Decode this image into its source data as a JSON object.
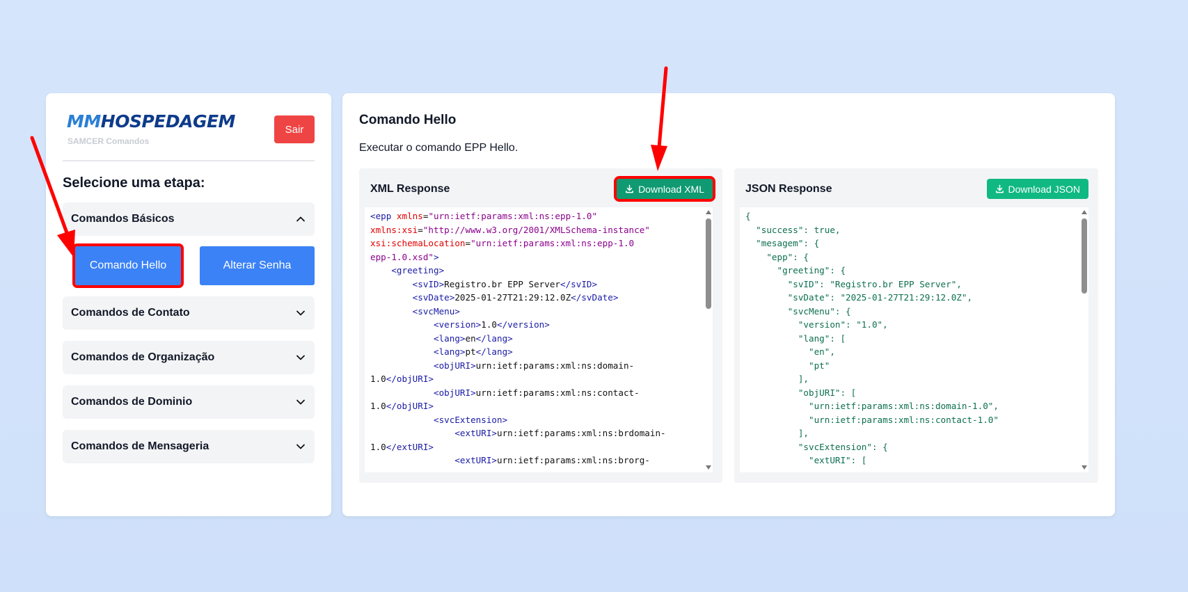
{
  "brand": {
    "logo_part1": "MM",
    "logo_part2": "HOSPEDAGEM",
    "subtitle": "SAMCER Comandos"
  },
  "header": {
    "logout_label": "Sair"
  },
  "sidebar": {
    "title": "Selecione uma etapa:",
    "sections": [
      {
        "label": "Comandos Básicos",
        "expanded": true
      },
      {
        "label": "Comandos de Contato",
        "expanded": false
      },
      {
        "label": "Comandos de Organização",
        "expanded": false
      },
      {
        "label": "Comandos de Dominio",
        "expanded": false
      },
      {
        "label": "Comandos de Mensageria",
        "expanded": false
      }
    ],
    "basic_commands": [
      "Comando Hello",
      "Alterar Senha"
    ]
  },
  "main": {
    "title": "Comando Hello",
    "description": "Executar o comando EPP Hello.",
    "xml": {
      "title": "XML Response",
      "download_label": "Download XML",
      "lines": [
        [
          [
            "t",
            "<epp "
          ],
          [
            "a",
            "xmlns"
          ],
          [
            "x",
            "="
          ],
          [
            "v",
            "\"urn:ietf:params:xml:ns:epp-1.0\""
          ]
        ],
        [
          [
            "a",
            "xmlns:xsi"
          ],
          [
            "x",
            "="
          ],
          [
            "v",
            "\"http://www.w3.org/2001/XMLSchema-instance\""
          ]
        ],
        [
          [
            "a",
            "xsi:schemaLocation"
          ],
          [
            "x",
            "="
          ],
          [
            "v",
            "\"urn:ietf:params:xml:ns:epp-1.0"
          ]
        ],
        [
          [
            "v",
            "epp-1.0.xsd\""
          ],
          [
            "t",
            ">"
          ]
        ],
        [
          [
            "x",
            "    "
          ],
          [
            "t",
            "<greeting>"
          ]
        ],
        [
          [
            "x",
            "        "
          ],
          [
            "t",
            "<svID>"
          ],
          [
            "x",
            "Registro.br EPP Server"
          ],
          [
            "t",
            "</svID>"
          ]
        ],
        [
          [
            "x",
            "        "
          ],
          [
            "t",
            "<svDate>"
          ],
          [
            "x",
            "2025-01-27T21:29:12.0Z"
          ],
          [
            "t",
            "</svDate>"
          ]
        ],
        [
          [
            "x",
            "        "
          ],
          [
            "t",
            "<svcMenu>"
          ]
        ],
        [
          [
            "x",
            "            "
          ],
          [
            "t",
            "<version>"
          ],
          [
            "x",
            "1.0"
          ],
          [
            "t",
            "</version>"
          ]
        ],
        [
          [
            "x",
            "            "
          ],
          [
            "t",
            "<lang>"
          ],
          [
            "x",
            "en"
          ],
          [
            "t",
            "</lang>"
          ]
        ],
        [
          [
            "x",
            "            "
          ],
          [
            "t",
            "<lang>"
          ],
          [
            "x",
            "pt"
          ],
          [
            "t",
            "</lang>"
          ]
        ],
        [
          [
            "x",
            "            "
          ],
          [
            "t",
            "<objURI>"
          ],
          [
            "x",
            "urn:ietf:params:xml:ns:domain-"
          ]
        ],
        [
          [
            "x",
            "1.0"
          ],
          [
            "t",
            "</objURI>"
          ]
        ],
        [
          [
            "x",
            "            "
          ],
          [
            "t",
            "<objURI>"
          ],
          [
            "x",
            "urn:ietf:params:xml:ns:contact-"
          ]
        ],
        [
          [
            "x",
            "1.0"
          ],
          [
            "t",
            "</objURI>"
          ]
        ],
        [
          [
            "x",
            "            "
          ],
          [
            "t",
            "<svcExtension>"
          ]
        ],
        [
          [
            "x",
            "                "
          ],
          [
            "t",
            "<extURI>"
          ],
          [
            "x",
            "urn:ietf:params:xml:ns:brdomain-"
          ]
        ],
        [
          [
            "x",
            "1.0"
          ],
          [
            "t",
            "</extURI>"
          ]
        ],
        [
          [
            "x",
            "                "
          ],
          [
            "t",
            "<extURI>"
          ],
          [
            "x",
            "urn:ietf:params:xml:ns:brorg-"
          ]
        ]
      ]
    },
    "json": {
      "title": "JSON Response",
      "download_label": "Download JSON",
      "lines": [
        "{",
        "  \"success\": true,",
        "  \"mesagem\": {",
        "    \"epp\": {",
        "      \"greeting\": {",
        "        \"svID\": \"Registro.br EPP Server\",",
        "        \"svDate\": \"2025-01-27T21:29:12.0Z\",",
        "        \"svcMenu\": {",
        "          \"version\": \"1.0\",",
        "          \"lang\": [",
        "            \"en\",",
        "            \"pt\"",
        "          ],",
        "          \"objURI\": [",
        "            \"urn:ietf:params:xml:ns:domain-1.0\",",
        "            \"urn:ietf:params:xml:ns:contact-1.0\"",
        "          ],",
        "          \"svcExtension\": {",
        "            \"extURI\": ["
      ]
    }
  },
  "colors": {
    "primary": "#3b82f6",
    "danger": "#ef4444",
    "success": "#10b981",
    "highlight": "#ff0000"
  }
}
